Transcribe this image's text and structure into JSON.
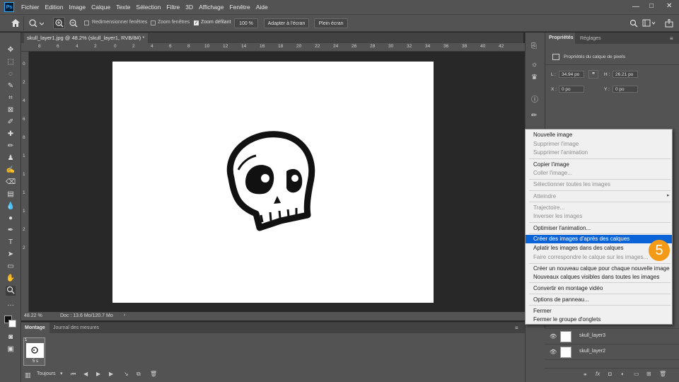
{
  "menubar": {
    "app_icon": "Ps",
    "items": [
      "Fichier",
      "Edition",
      "Image",
      "Calque",
      "Texte",
      "Sélection",
      "Filtre",
      "3D",
      "Affichage",
      "Fenêtre",
      "Aide"
    ],
    "win_min": "—",
    "win_max": "□",
    "win_close": "✕"
  },
  "options_bar": {
    "home_icon": "home-icon",
    "zoom_icon": "zoom-icon",
    "chk_resize": "Redimensionner fenêtres",
    "chk_zoom_windows": "Zoom fenêtres",
    "chk_scrubby": "Zoom défilant",
    "zoom_value": "100 %",
    "fit_screen": "Adapter à l'écran",
    "fill_screen": "Plein écran"
  },
  "document": {
    "tab_title": "skull_layer1.jpg @ 48.2% (skull_layer1, RVB/8#) *",
    "tab_close": "×",
    "ruler_h": [
      "8",
      "6",
      "4",
      "2",
      "0",
      "2",
      "4",
      "6",
      "8",
      "10",
      "12",
      "14",
      "16",
      "18",
      "20",
      "22",
      "24",
      "26",
      "28",
      "30",
      "32",
      "34",
      "36",
      "38",
      "40",
      "42"
    ],
    "ruler_v": [
      "0",
      "2",
      "4",
      "6",
      "8",
      "1",
      "1",
      "1",
      "1",
      "2",
      "2"
    ],
    "status_zoom": "48.22 %",
    "status_doc": "Doc : 13.6 Mo/120.7 Mo",
    "status_arrow": "›"
  },
  "timeline": {
    "tab_montage": "Montage",
    "tab_journal": "Journal des mesures",
    "frame_number": "1",
    "frame_delay": "5 s",
    "loop": "Toujours"
  },
  "properties": {
    "tab_props": "Propriétés",
    "tab_reglages": "Réglages",
    "subtitle": "Propriétés du calque de pixels",
    "w_label": "L :",
    "w_value": "34.94 po",
    "h_label": "H :",
    "h_value": "26.21 po",
    "x_label": "X :",
    "x_value": "0 po",
    "y_label": "Y :",
    "y_value": "0 po"
  },
  "context_menu": {
    "items": [
      {
        "label": "Nouvelle image",
        "state": "enabled"
      },
      {
        "label": "Supprimer l'image",
        "state": "disabled"
      },
      {
        "label": "Supprimer l'animation",
        "state": "disabled"
      },
      {
        "label": "Copier l'image",
        "state": "enabled"
      },
      {
        "label": "Coller l'image...",
        "state": "disabled"
      },
      {
        "label": "Sélectionner toutes les images",
        "state": "disabled"
      },
      {
        "label": "Atteindre",
        "state": "disabled"
      },
      {
        "label": "Trajectoire...",
        "state": "disabled"
      },
      {
        "label": "Inverser les images",
        "state": "disabled"
      },
      {
        "label": "Optimiser l'animation...",
        "state": "enabled"
      },
      {
        "label": "Créer des images d'après des calques",
        "state": "highlighted"
      },
      {
        "label": "Aplatir les images dans des calques",
        "state": "enabled"
      },
      {
        "label": "Faire correspondre le calque sur les images...",
        "state": "disabled"
      },
      {
        "label": "Créer un nouveau calque pour chaque nouvelle image",
        "state": "enabled"
      },
      {
        "label": "Nouveaux calques visibles dans toutes les images",
        "state": "enabled"
      },
      {
        "label": "Convertir en montage vidéo",
        "state": "enabled"
      },
      {
        "label": "Options de panneau...",
        "state": "enabled"
      },
      {
        "label": "Fermer",
        "state": "enabled"
      },
      {
        "label": "Fermer le groupe d'onglets",
        "state": "enabled"
      }
    ],
    "submenu_arrow": "▸"
  },
  "step_badge": "5",
  "layers": [
    {
      "name": "skull_layer3"
    },
    {
      "name": "skull_layer2"
    }
  ],
  "colors": {
    "ui_panel": "#535353",
    "canvas_bg": "#282828",
    "highlight": "#0a64d8",
    "badge": "#f39a17",
    "ps_blue": "#31a8ff"
  }
}
